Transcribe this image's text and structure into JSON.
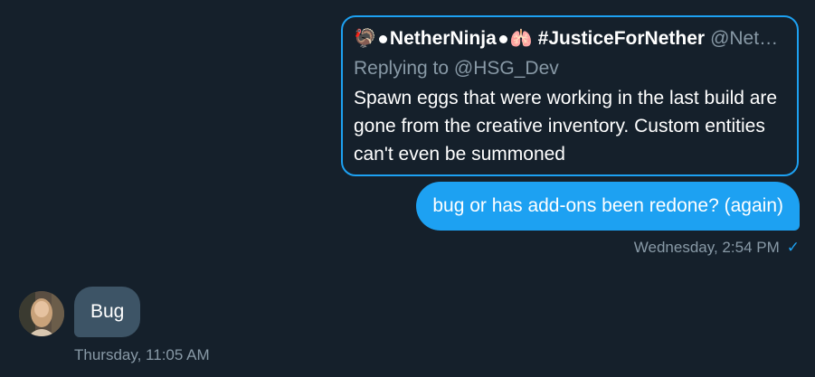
{
  "quoted_tweet": {
    "emoji_left": "🦃",
    "name": "NetherNinja",
    "emoji_right": "🫁",
    "hashtag": "#JusticeForNether",
    "handle": "@Net…",
    "replying_prefix": "Replying to",
    "replying_to": "@HSG_Dev",
    "text": "Spawn eggs that were working in the last build are gone from the creative inventory. Custom entities can't even be summoned"
  },
  "sent_message": {
    "text": "bug or has add-ons been redone? (again)",
    "timestamp": "Wednesday, 2:54 PM",
    "status_icon": "check-icon"
  },
  "received_message": {
    "text": "Bug",
    "timestamp": "Thursday, 11:05 AM"
  },
  "colors": {
    "background": "#15202b",
    "accent": "#1da1f2",
    "received_bubble": "#3d5466",
    "muted_text": "#8899a6"
  }
}
